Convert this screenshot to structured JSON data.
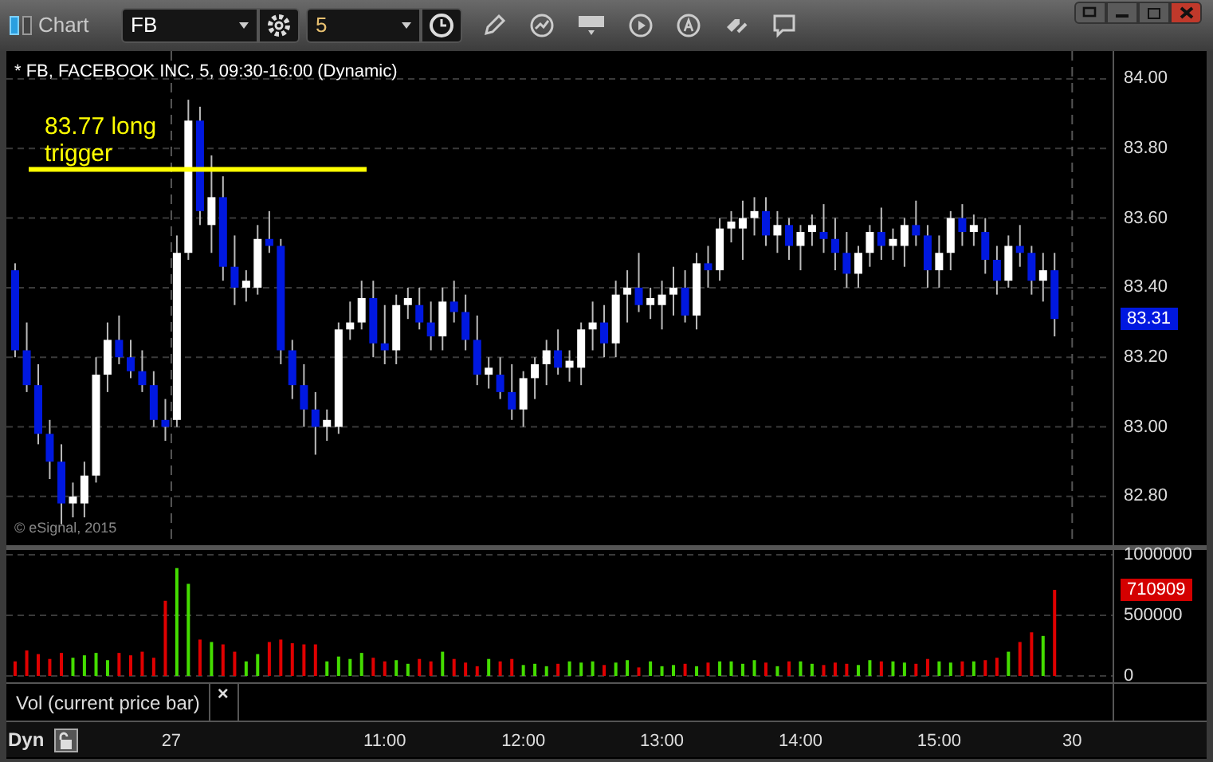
{
  "window": {
    "title": "Chart"
  },
  "toolbar": {
    "symbol": "FB",
    "interval": "5"
  },
  "price_pane": {
    "legend": "* FB, FACEBOOK INC, 5, 09:30-16:00 (Dynamic)",
    "annotation": "83.77 long trigger",
    "copyright": "© eSignal, 2015",
    "price_badge": "83.31",
    "chart_data": {
      "type": "candlestick",
      "grid": true,
      "x": [
        8.333,
        8.417,
        8.5,
        8.583,
        8.667,
        8.75,
        8.833,
        8.917,
        9,
        9.083,
        9.167,
        9.25,
        9.333,
        9.417,
        9.5,
        9.583,
        9.667,
        9.75,
        9.833,
        9.917,
        10,
        10.083,
        10.167,
        10.25,
        10.333,
        10.417,
        10.5,
        10.583,
        10.667,
        10.75,
        10.833,
        10.917,
        11,
        11.083,
        11.167,
        11.25,
        11.333,
        11.417,
        11.5,
        11.583,
        11.667,
        11.75,
        11.833,
        11.917,
        12,
        12.083,
        12.167,
        12.25,
        12.333,
        12.417,
        12.5,
        12.583,
        12.667,
        12.75,
        12.833,
        12.917,
        13,
        13.083,
        13.167,
        13.25,
        13.333,
        13.417,
        13.5,
        13.583,
        13.667,
        13.75,
        13.833,
        13.917,
        14,
        14.083,
        14.167,
        14.25,
        14.333,
        14.417,
        14.5,
        14.583,
        14.667,
        14.75,
        14.833,
        14.917,
        15,
        15.083,
        15.167,
        15.25,
        15.333,
        15.417,
        15.5,
        15.583,
        15.667,
        15.75,
        15.833
      ],
      "ohlc": [
        [
          83.45,
          83.47,
          83.2,
          83.22
        ],
        [
          83.22,
          83.3,
          83.1,
          83.12
        ],
        [
          83.12,
          83.18,
          82.95,
          82.98
        ],
        [
          82.98,
          83.02,
          82.85,
          82.9
        ],
        [
          82.9,
          82.95,
          82.72,
          82.78
        ],
        [
          82.78,
          82.84,
          82.74,
          82.8
        ],
        [
          82.78,
          82.9,
          82.74,
          82.86
        ],
        [
          82.86,
          83.2,
          82.84,
          83.15
        ],
        [
          83.15,
          83.3,
          83.1,
          83.25
        ],
        [
          83.25,
          83.32,
          83.18,
          83.2
        ],
        [
          83.2,
          83.25,
          83.14,
          83.16
        ],
        [
          83.16,
          83.22,
          83.1,
          83.12
        ],
        [
          83.12,
          83.16,
          83.0,
          83.02
        ],
        [
          83.02,
          83.08,
          82.96,
          83.0
        ],
        [
          83.02,
          83.55,
          83.0,
          83.5
        ],
        [
          83.5,
          83.94,
          83.48,
          83.88
        ],
        [
          83.88,
          83.92,
          83.58,
          83.62
        ],
        [
          83.58,
          83.78,
          83.5,
          83.66
        ],
        [
          83.66,
          83.72,
          83.42,
          83.46
        ],
        [
          83.46,
          83.55,
          83.35,
          83.4
        ],
        [
          83.4,
          83.45,
          83.36,
          83.42
        ],
        [
          83.4,
          83.58,
          83.38,
          83.54
        ],
        [
          83.54,
          83.62,
          83.5,
          83.52
        ],
        [
          83.52,
          83.54,
          83.18,
          83.22
        ],
        [
          83.22,
          83.25,
          83.08,
          83.12
        ],
        [
          83.12,
          83.18,
          83.0,
          83.05
        ],
        [
          83.05,
          83.1,
          82.92,
          83.0
        ],
        [
          83.0,
          83.05,
          82.96,
          83.02
        ],
        [
          83.0,
          83.3,
          82.98,
          83.28
        ],
        [
          83.28,
          83.36,
          83.25,
          83.3
        ],
        [
          83.3,
          83.42,
          83.28,
          83.37
        ],
        [
          83.37,
          83.42,
          83.2,
          83.24
        ],
        [
          83.24,
          83.35,
          83.18,
          83.22
        ],
        [
          83.22,
          83.38,
          83.18,
          83.35
        ],
        [
          83.35,
          83.4,
          83.31,
          83.37
        ],
        [
          83.35,
          83.4,
          83.28,
          83.3
        ],
        [
          83.3,
          83.36,
          83.22,
          83.26
        ],
        [
          83.26,
          83.4,
          83.22,
          83.36
        ],
        [
          83.36,
          83.42,
          83.3,
          83.33
        ],
        [
          83.33,
          83.38,
          83.22,
          83.25
        ],
        [
          83.25,
          83.32,
          83.12,
          83.15
        ],
        [
          83.15,
          83.2,
          83.11,
          83.17
        ],
        [
          83.15,
          83.2,
          83.08,
          83.1
        ],
        [
          83.1,
          83.18,
          83.02,
          83.05
        ],
        [
          83.05,
          83.16,
          83.0,
          83.14
        ],
        [
          83.14,
          83.2,
          83.08,
          83.18
        ],
        [
          83.18,
          83.25,
          83.12,
          83.22
        ],
        [
          83.22,
          83.28,
          83.15,
          83.17
        ],
        [
          83.17,
          83.22,
          83.13,
          83.19
        ],
        [
          83.17,
          83.3,
          83.12,
          83.28
        ],
        [
          83.28,
          83.36,
          83.22,
          83.3
        ],
        [
          83.3,
          83.35,
          83.2,
          83.24
        ],
        [
          83.24,
          83.42,
          83.2,
          83.38
        ],
        [
          83.38,
          83.45,
          83.3,
          83.4
        ],
        [
          83.4,
          83.5,
          83.33,
          83.35
        ],
        [
          83.35,
          83.4,
          83.31,
          83.37
        ],
        [
          83.35,
          83.42,
          83.28,
          83.38
        ],
        [
          83.38,
          83.46,
          83.32,
          83.4
        ],
        [
          83.4,
          83.45,
          83.3,
          83.32
        ],
        [
          83.32,
          83.5,
          83.28,
          83.47
        ],
        [
          83.47,
          83.52,
          83.4,
          83.45
        ],
        [
          83.45,
          83.6,
          83.42,
          83.57
        ],
        [
          83.57,
          83.62,
          83.53,
          83.59
        ],
        [
          83.57,
          83.65,
          83.48,
          83.6
        ],
        [
          83.6,
          83.66,
          83.55,
          83.62
        ],
        [
          83.62,
          83.66,
          83.52,
          83.55
        ],
        [
          83.55,
          83.62,
          83.5,
          83.58
        ],
        [
          83.58,
          83.6,
          83.48,
          83.52
        ],
        [
          83.52,
          83.58,
          83.45,
          83.56
        ],
        [
          83.56,
          83.61,
          83.52,
          83.58
        ],
        [
          83.56,
          83.64,
          83.5,
          83.54
        ],
        [
          83.54,
          83.6,
          83.45,
          83.5
        ],
        [
          83.5,
          83.56,
          83.4,
          83.44
        ],
        [
          83.44,
          83.52,
          83.4,
          83.5
        ],
        [
          83.5,
          83.58,
          83.46,
          83.56
        ],
        [
          83.56,
          83.63,
          83.48,
          83.52
        ],
        [
          83.52,
          83.57,
          83.48,
          83.54
        ],
        [
          83.52,
          83.6,
          83.46,
          83.58
        ],
        [
          83.58,
          83.65,
          83.52,
          83.55
        ],
        [
          83.55,
          83.58,
          83.4,
          83.45
        ],
        [
          83.45,
          83.55,
          83.4,
          83.5
        ],
        [
          83.5,
          83.62,
          83.45,
          83.6
        ],
        [
          83.6,
          83.64,
          83.52,
          83.56
        ],
        [
          83.56,
          83.61,
          83.52,
          83.58
        ],
        [
          83.56,
          83.6,
          83.44,
          83.48
        ],
        [
          83.48,
          83.52,
          83.38,
          83.42
        ],
        [
          83.42,
          83.55,
          83.4,
          83.52
        ],
        [
          83.52,
          83.58,
          83.46,
          83.5
        ],
        [
          83.5,
          83.52,
          83.38,
          83.42
        ],
        [
          83.42,
          83.5,
          83.36,
          83.45
        ],
        [
          83.45,
          83.5,
          83.26,
          83.31
        ]
      ],
      "xlim": [
        8.27,
        16.93
      ],
      "ylim": [
        82.66,
        84.08
      ],
      "yticks": [
        {
          "value": 84.0,
          "label": "84.00"
        },
        {
          "value": 83.8,
          "label": "83.80"
        },
        {
          "value": 83.6,
          "label": "83.60"
        },
        {
          "value": 83.4,
          "label": "83.40"
        },
        {
          "value": 83.2,
          "label": "83.20"
        },
        {
          "value": 83.0,
          "label": "83.00"
        },
        {
          "value": 82.8,
          "label": "82.80"
        }
      ],
      "ref_lines": [
        {
          "axis": "y",
          "value": 83.74,
          "color": "#ffff00"
        },
        {
          "axis": "x",
          "value": 9.46,
          "color": "#555555"
        },
        {
          "axis": "x",
          "value": 15.96,
          "color": "#555555"
        }
      ]
    }
  },
  "volume_pane": {
    "volume_badge": "710909",
    "date_labels": [
      "27",
      "30"
    ],
    "study_label": "Vol (current price bar)",
    "study_close": "×",
    "mode": "Dyn",
    "chart_data": {
      "type": "bar",
      "grid": true,
      "x": [
        8.333,
        8.417,
        8.5,
        8.583,
        8.667,
        8.75,
        8.833,
        8.917,
        9,
        9.083,
        9.167,
        9.25,
        9.333,
        9.417,
        9.5,
        9.583,
        9.667,
        9.75,
        9.833,
        9.917,
        10,
        10.083,
        10.167,
        10.25,
        10.333,
        10.417,
        10.5,
        10.583,
        10.667,
        10.75,
        10.833,
        10.917,
        11,
        11.083,
        11.167,
        11.25,
        11.333,
        11.417,
        11.5,
        11.583,
        11.667,
        11.75,
        11.833,
        11.917,
        12,
        12.083,
        12.167,
        12.25,
        12.333,
        12.417,
        12.5,
        12.583,
        12.667,
        12.75,
        12.833,
        12.917,
        13,
        13.083,
        13.167,
        13.25,
        13.333,
        13.417,
        13.5,
        13.583,
        13.667,
        13.75,
        13.833,
        13.917,
        14,
        14.083,
        14.167,
        14.25,
        14.333,
        14.417,
        14.5,
        14.583,
        14.667,
        14.75,
        14.833,
        14.917,
        15,
        15.083,
        15.167,
        15.25,
        15.333,
        15.417,
        15.5,
        15.583,
        15.667,
        15.75,
        15.833
      ],
      "values": [
        120000,
        210000,
        180000,
        140000,
        190000,
        150000,
        170000,
        190000,
        130000,
        190000,
        170000,
        200000,
        150000,
        620000,
        890000,
        760000,
        300000,
        280000,
        260000,
        200000,
        120000,
        180000,
        280000,
        300000,
        270000,
        260000,
        260000,
        120000,
        160000,
        140000,
        190000,
        150000,
        120000,
        130000,
        100000,
        140000,
        120000,
        200000,
        140000,
        110000,
        80000,
        140000,
        120000,
        140000,
        90000,
        100000,
        80000,
        100000,
        120000,
        110000,
        120000,
        90000,
        110000,
        130000,
        70000,
        120000,
        80000,
        90000,
        100000,
        80000,
        110000,
        120000,
        120000,
        100000,
        130000,
        110000,
        80000,
        120000,
        120000,
        100000,
        90000,
        110000,
        100000,
        90000,
        130000,
        120000,
        120000,
        110000,
        100000,
        140000,
        120000,
        110000,
        120000,
        120000,
        130000,
        150000,
        200000,
        280000,
        360000,
        330000,
        710000
      ],
      "xlim": [
        8.27,
        16.93
      ],
      "ylim": [
        0,
        1000000
      ],
      "yticks": [
        1000000,
        500000,
        0
      ],
      "xticks": [
        {
          "value": 11,
          "label": "11:00"
        },
        {
          "value": 12,
          "label": "12:00"
        },
        {
          "value": 13,
          "label": "13:00"
        },
        {
          "value": 14,
          "label": "14:00"
        },
        {
          "value": 15,
          "label": "15:00"
        }
      ]
    }
  }
}
